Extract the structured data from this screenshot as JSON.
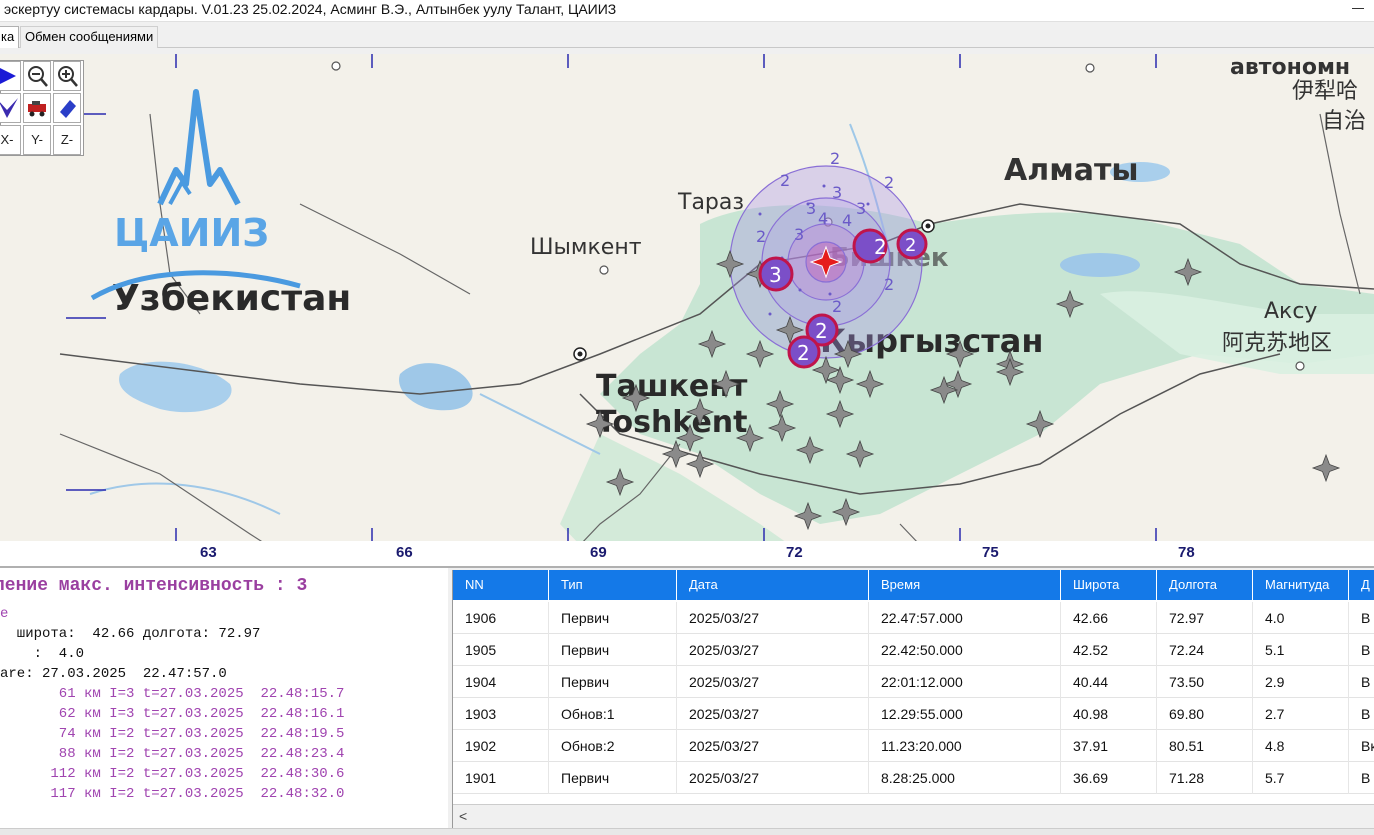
{
  "window": {
    "title": "эскертуу системасы кардары. V.01.23 25.02.2024, Асминг В.Э., Алтынбек уулу Талант, ЦАИИЗ"
  },
  "tabs": [
    {
      "label": "ка",
      "active": true
    },
    {
      "label": "Обмен сообщениями",
      "active": false
    }
  ],
  "toolbar": {
    "buttons": [
      {
        "icon": "play-arrow-icon"
      },
      {
        "icon": "zoom-out-icon"
      },
      {
        "icon": "zoom-in-icon"
      },
      {
        "icon": "pointer-check-icon"
      },
      {
        "icon": "vehicle-icon"
      },
      {
        "icon": "eraser-icon"
      },
      {
        "label": "X-"
      },
      {
        "label": "Y-"
      },
      {
        "label": "Z-"
      }
    ]
  },
  "map": {
    "logo_text": "ЦАИИЗ",
    "labels": {
      "uzbekistan": "Узбекистан",
      "shymkent": "Шымкент",
      "taraz": "Тараз",
      "almaty": "Алматы",
      "bishkek": "Бишкек",
      "kyrgyzstan": "Кыргызстан",
      "tashkent": "Ташкент",
      "toshkent": "Toshkent",
      "aksu": "Аксу",
      "aksu_cn": "阿克苏地区",
      "autonomous": "автономн",
      "ili_cn": "伊犁哈",
      "zizhi_cn": "自治"
    },
    "x_ticks": [
      "63",
      "66",
      "69",
      "72",
      "75",
      "78"
    ],
    "circle_labels": [
      "2",
      "3",
      "4"
    ],
    "markers": [
      {
        "label": "3"
      },
      {
        "label": "2"
      },
      {
        "label": "2"
      },
      {
        "label": "2"
      },
      {
        "label": "2"
      }
    ],
    "colors": {
      "circle": "#8a6fd6",
      "marker": "#c0144a",
      "epicenter": "#e51c1c",
      "star": "#8a8a8a"
    }
  },
  "info": {
    "heading": "ление макс. интенсивность : 3",
    "sub": "е",
    "lat_line": "  широта:  42.66 долгота: 72.97",
    "mag_line": "    :  4.0",
    "date_line": "are: 27.03.2025  22.47:57.0",
    "stations": [
      "       61 км I=3 t=27.03.2025  22.48:15.7",
      "       62 км I=3 t=27.03.2025  22.48:16.1",
      "       74 км I=2 t=27.03.2025  22.48:19.5",
      "       88 км I=2 t=27.03.2025  22.48:23.4",
      "      112 км I=2 t=27.03.2025  22.48:30.6",
      "      117 км I=2 t=27.03.2025  22.48:32.0"
    ]
  },
  "table": {
    "columns": [
      "NN",
      "Тип",
      "Дата",
      "Время",
      "Широта",
      "Долгота",
      "Магнитуда",
      "Д"
    ],
    "rows": [
      [
        "1906",
        "Первич",
        "2025/03/27",
        "22.47:57.000",
        "42.66",
        "72.97",
        "4.0",
        "В"
      ],
      [
        "1905",
        "Первич",
        "2025/03/27",
        "22.42:50.000",
        "42.52",
        "72.24",
        "5.1",
        "В"
      ],
      [
        "1904",
        "Первич",
        "2025/03/27",
        "22:01:12.000",
        "40.44",
        "73.50",
        "2.9",
        "В"
      ],
      [
        "1903",
        "Обнов:1",
        "2025/03/27",
        "12.29:55.000",
        "40.98",
        "69.80",
        "2.7",
        "В"
      ],
      [
        "1902",
        "Обнов:2",
        "2025/03/27",
        "11.23:20.000",
        "37.91",
        "80.51",
        "4.8",
        "Вк"
      ],
      [
        "1901",
        "Первич",
        "2025/03/27",
        "8.28:25.000",
        "36.69",
        "71.28",
        "5.7",
        "В"
      ]
    ],
    "scroll_left": "<"
  }
}
